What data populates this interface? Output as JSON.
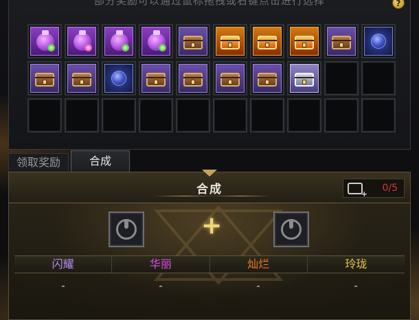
{
  "hint_text": "部分奖励可以通过鼠标拖拽或右键点击进行选择",
  "help_icon": "?",
  "inventory": {
    "slots": [
      {
        "type": "bag",
        "icon": "purple-bag-icon",
        "gem": "green"
      },
      {
        "type": "bag",
        "icon": "purple-bag-icon",
        "gem": "pink"
      },
      {
        "type": "bag",
        "icon": "purple-bag-icon",
        "gem": "green"
      },
      {
        "type": "bag",
        "icon": "purple-bag-icon",
        "gem": "green"
      },
      {
        "type": "chest-purple",
        "icon": "wooden-chest-icon"
      },
      {
        "type": "chest-gold",
        "icon": "golden-chest-icon"
      },
      {
        "type": "chest-gold",
        "icon": "golden-chest-icon"
      },
      {
        "type": "chest-gold",
        "icon": "golden-chest-icon"
      },
      {
        "type": "chest-purple",
        "icon": "wooden-chest-icon"
      },
      {
        "type": "orb",
        "icon": "blue-orb-icon"
      },
      {
        "type": "chest-purple",
        "icon": "wooden-chest-icon"
      },
      {
        "type": "chest-purple",
        "icon": "wooden-chest-icon"
      },
      {
        "type": "orb",
        "icon": "blue-orb-icon"
      },
      {
        "type": "chest-purple",
        "icon": "wooden-chest-icon"
      },
      {
        "type": "chest-purple",
        "icon": "wooden-chest-icon"
      },
      {
        "type": "chest-purple",
        "icon": "wooden-chest-icon"
      },
      {
        "type": "chest-purple",
        "icon": "wooden-chest-icon"
      },
      {
        "type": "chest-silver",
        "icon": "silver-chest-icon"
      },
      {
        "type": "empty"
      },
      {
        "type": "empty"
      },
      {
        "type": "empty"
      },
      {
        "type": "empty"
      },
      {
        "type": "empty"
      },
      {
        "type": "empty"
      },
      {
        "type": "empty"
      },
      {
        "type": "empty"
      },
      {
        "type": "empty"
      },
      {
        "type": "empty"
      },
      {
        "type": "empty"
      },
      {
        "type": "empty"
      }
    ]
  },
  "tabs": [
    {
      "label": "领取奖励",
      "active": false
    },
    {
      "label": "合成",
      "active": true
    }
  ],
  "synth": {
    "title": "合成",
    "counter": "0/5",
    "plus": "+",
    "qualities": [
      {
        "name": "闪耀",
        "color": "#b48cf0",
        "value": "-"
      },
      {
        "name": "华丽",
        "color": "#e04ce8",
        "value": "-"
      },
      {
        "name": "灿烂",
        "color": "#f07a20",
        "value": "-"
      },
      {
        "name": "玲珑",
        "color": "#e8c24a",
        "value": "-"
      }
    ]
  }
}
